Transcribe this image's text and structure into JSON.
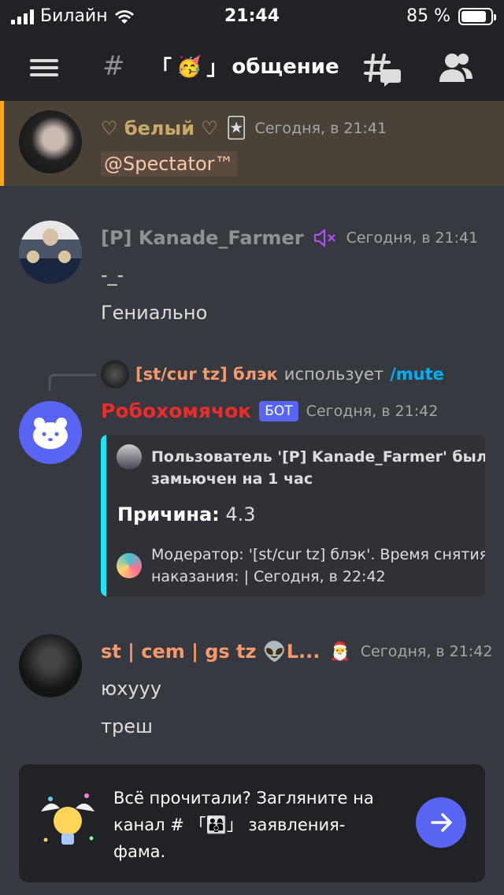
{
  "status": {
    "carrier": "Билайн",
    "time": "21:44",
    "battery": "85 %",
    "battery_level": 0.85
  },
  "header": {
    "channel_hash": "#",
    "channel_deco_left": "「",
    "channel_emoji": "🥳",
    "channel_deco_right": "」",
    "channel_name": "общение"
  },
  "messages": [
    {
      "author": "♡ белый ♡",
      "author_emoji": "🃏",
      "time": "Сегодня, в 21:41",
      "mention": "@Spectator™"
    },
    {
      "author": "[P] Kanade_Farmer",
      "time": "Сегодня, в 21:41",
      "lines": [
        "-_-",
        "Гениально"
      ]
    },
    {
      "reply_user": "[st/cur tz] блэк",
      "reply_action": "использует",
      "reply_command": "/mute",
      "author": "Робохомячок",
      "bot_tag": "БОТ",
      "time": "Сегодня, в 21:42",
      "embed": {
        "title_line1": "Пользователь '[P] Kanade_Farmer' был",
        "title_line2": "замьючен на 1 час",
        "field_name": "Причина:",
        "field_value": "4.3",
        "footer_line1": "Модератор: '[st/cur tz] блэк'. Время снятия",
        "footer_line2": "наказания: | Сегодня, в 22:42",
        "accent_color": "#1ee5f2"
      }
    },
    {
      "author": "st | cem | gs tz 👽L...",
      "author_emoji": "🎅",
      "time": "Сегодня, в 21:42",
      "lines": [
        "юхууу",
        "треш"
      ]
    }
  ],
  "banner": {
    "line1": "Всё прочитали? Загляните на",
    "line2_prefix": "канал #",
    "line2_deco_left": "「",
    "line2_emoji": "👨‍👩‍👦",
    "line2_deco_right": "」",
    "line2_suffix": "заявления-",
    "line3": "фама."
  },
  "colors": {
    "bot_name": "#ed2b2b",
    "orange_name": "#f79a6b",
    "gold_name": "#c9a96a",
    "muted_name": "#8e9297",
    "bot_tag": "#5865f2",
    "command": "#00aff4",
    "mute_icon": "#b44ef2",
    "highlight_border": "#faa61a"
  },
  "icons": [
    "hamburger-icon",
    "hash-icon",
    "threads-icon",
    "members-icon",
    "muted-speaker-icon",
    "arrow-right-icon",
    "lightbulb-icon"
  ]
}
